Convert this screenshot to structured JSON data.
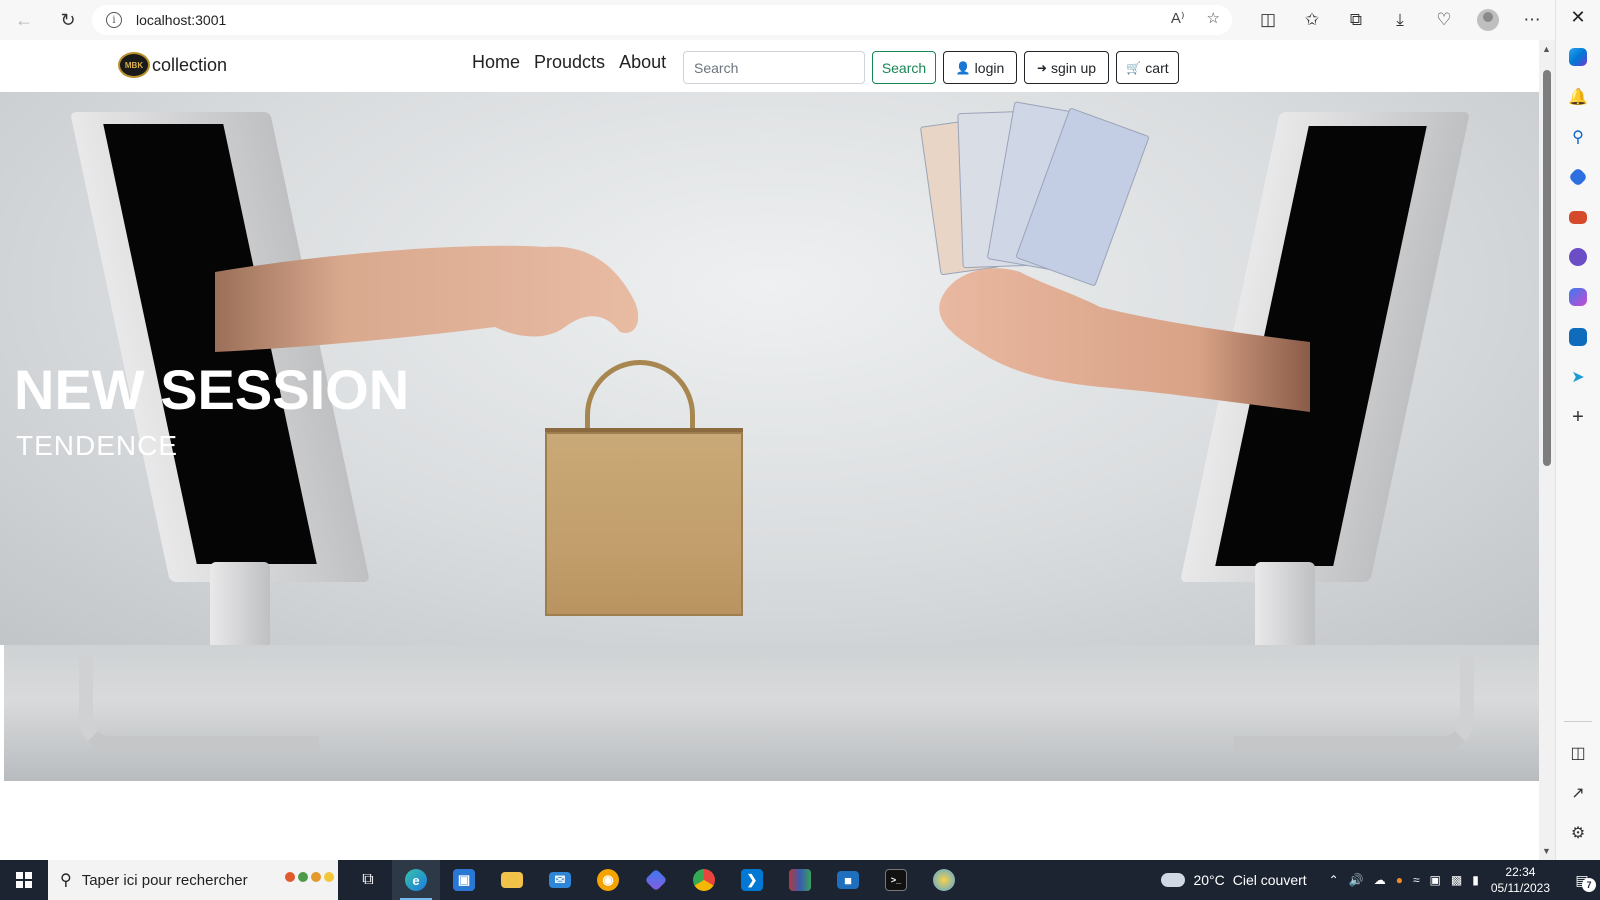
{
  "browser": {
    "url": "localhost:3001",
    "back_icon": "back-arrow-icon",
    "reload_icon": "reload-icon",
    "info_glyph": "i",
    "read_aloud_glyph": "A⁾",
    "favorite_glyph": "☆"
  },
  "site": {
    "brand_logo_text": "MBK",
    "brand_name": "collection",
    "nav": {
      "home": "Home",
      "products": "Proudcts",
      "about": "About"
    },
    "search_placeholder": "Search",
    "search_button": "Search",
    "login_button": "login",
    "signup_button": "sgin up",
    "cart_button": "cart"
  },
  "hero": {
    "title": "NEW SESSION",
    "subtitle": "TENDENCE"
  },
  "taskbar": {
    "search_placeholder": "Taper ici pour rechercher",
    "weather_temp": "20°C",
    "weather_text": "Ciel couvert",
    "time": "22:34",
    "date": "05/11/2023",
    "notification_count": "7"
  },
  "colors": {
    "search_button": "#198754",
    "dark_button": "#212529",
    "taskbar_bg": "#1b2430",
    "edge_accent": "#0078d4"
  }
}
